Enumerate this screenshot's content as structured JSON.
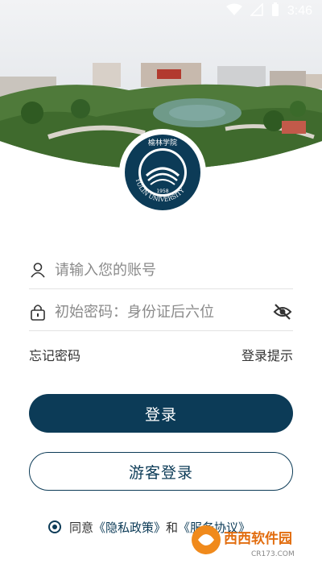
{
  "status_bar": {
    "time": "3:46"
  },
  "logo": {
    "text_top": "榆林学院",
    "text_ring": "YULIN UNIVERSITY",
    "year": "1958"
  },
  "login": {
    "account_placeholder": "请输入您的账号",
    "password_placeholder": "初始密码：身份证后六位",
    "forgot_password": "忘记密码",
    "login_hint": "登录提示",
    "login_button": "登录",
    "guest_login_button": "游客登录"
  },
  "agreement": {
    "prefix": "同意",
    "privacy_policy": "《隐私政策》",
    "and": "和",
    "service_agreement": "《服务协议》"
  },
  "watermark": {
    "brand": "西西软件园",
    "url": "CR173.COM"
  },
  "colors": {
    "primary": "#0c3b57",
    "status_text": "#ffffff"
  }
}
